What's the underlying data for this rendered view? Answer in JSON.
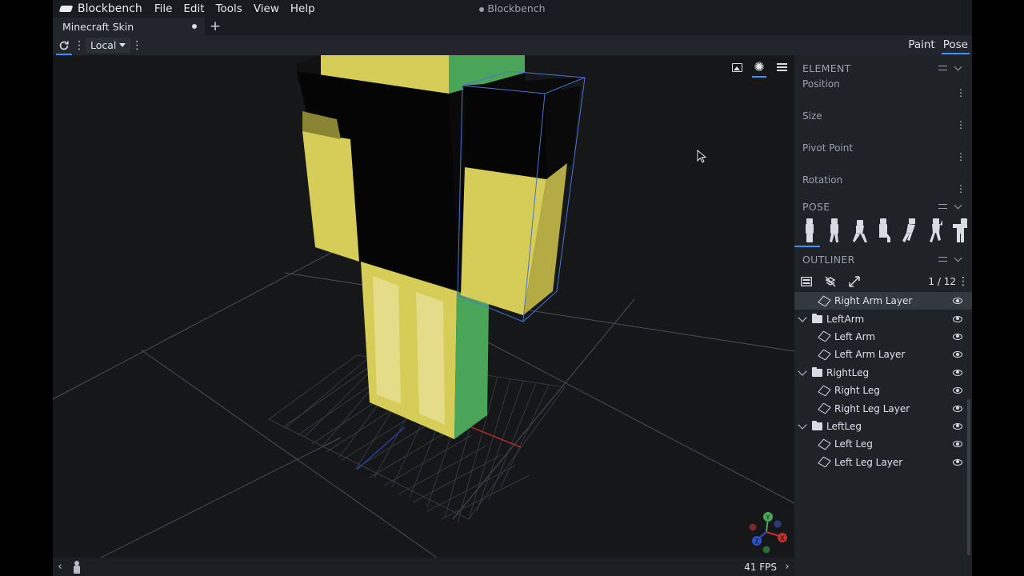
{
  "app": {
    "name": "Blockbench",
    "window_title": "Blockbench",
    "menu": [
      "File",
      "Edit",
      "Tools",
      "View",
      "Help"
    ]
  },
  "tabs": [
    {
      "label": "Minecraft Skin",
      "unsaved": true
    }
  ],
  "toolbar": {
    "space_dropdown": "Local",
    "modes": [
      "Paint",
      "Pose"
    ],
    "active_mode": "Pose"
  },
  "viewport": {
    "toolbar_icons": [
      "image-icon",
      "sun-icon",
      "menu-icon"
    ],
    "gizmo_axes": [
      "Y",
      "X",
      "Z"
    ]
  },
  "status": {
    "fps": "41 FPS"
  },
  "element_panel": {
    "title": "ELEMENT",
    "properties": [
      "Position",
      "Size",
      "Pivot Point",
      "Rotation"
    ]
  },
  "pose_panel": {
    "title": "POSE",
    "presets": [
      "natural",
      "walking",
      "crouching",
      "sitting",
      "running",
      "jumping",
      "flying"
    ]
  },
  "outliner": {
    "title": "OUTLINER",
    "count": "1 / 12",
    "items": [
      {
        "label": "Right Arm Layer",
        "type": "cube",
        "selected": true
      },
      {
        "label": "LeftArm",
        "type": "group"
      },
      {
        "label": "Left Arm",
        "type": "cube"
      },
      {
        "label": "Left Arm Layer",
        "type": "cube"
      },
      {
        "label": "RightLeg",
        "type": "group"
      },
      {
        "label": "Right Leg",
        "type": "cube"
      },
      {
        "label": "Right Leg Layer",
        "type": "cube"
      },
      {
        "label": "LeftLeg",
        "type": "group"
      },
      {
        "label": "Left Leg",
        "type": "cube"
      },
      {
        "label": "Left Leg Layer",
        "type": "cube"
      }
    ]
  },
  "colors": {
    "accent": "#3e90ff",
    "skin_yellow": "#d6cc58",
    "skin_green": "#4aa559",
    "skin_black": "#050505"
  }
}
